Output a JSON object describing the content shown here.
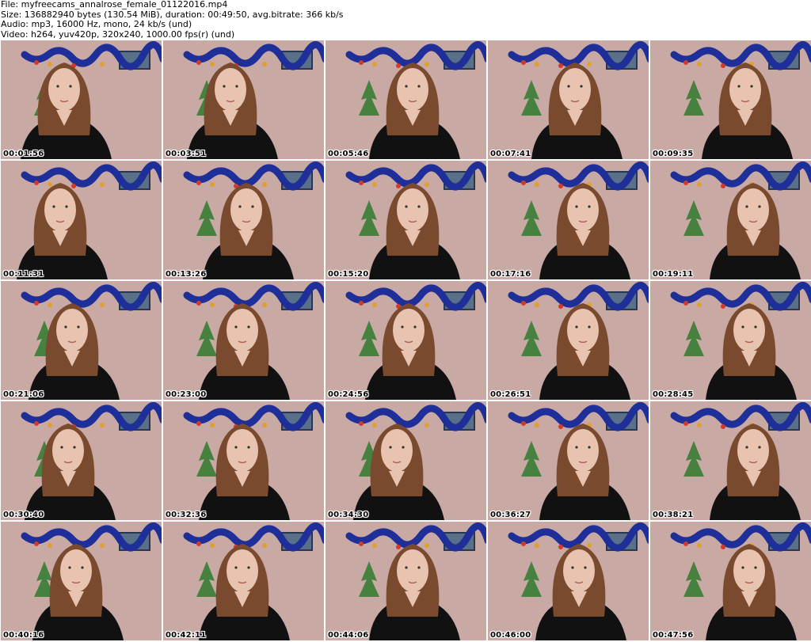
{
  "header": {
    "line1": "File: myfreecams_annalrose_female_01122016.mp4",
    "line2": "Size: 136882940 bytes (130.54 MiB), duration: 00:49:50, avg.bitrate: 366 kb/s",
    "line3": "Audio: mp3, 16000 Hz, mono, 24 kb/s (und)",
    "line4": "Video: h264, yuv420p, 320x240, 1000.00 fps(r) (und)"
  },
  "thumbnails": [
    "00:01:56",
    "00:03:51",
    "00:05:46",
    "00:07:41",
    "00:09:35",
    "00:11:31",
    "00:13:26",
    "00:15:20",
    "00:17:16",
    "00:19:11",
    "00:21:06",
    "00:23:00",
    "00:24:56",
    "00:26:51",
    "00:28:45",
    "00:30:40",
    "00:32:36",
    "00:34:30",
    "00:36:27",
    "00:38:21",
    "00:40:16",
    "00:42:11",
    "00:44:06",
    "00:46:00",
    "00:47:56"
  ],
  "colors": {
    "wall": "#c9a9a3",
    "tinsel": "#1f2f9a",
    "hair": "#7a4a2e",
    "skin": "#e8c3b0",
    "shirt": "#111111",
    "tree": "#2f7a2f"
  }
}
